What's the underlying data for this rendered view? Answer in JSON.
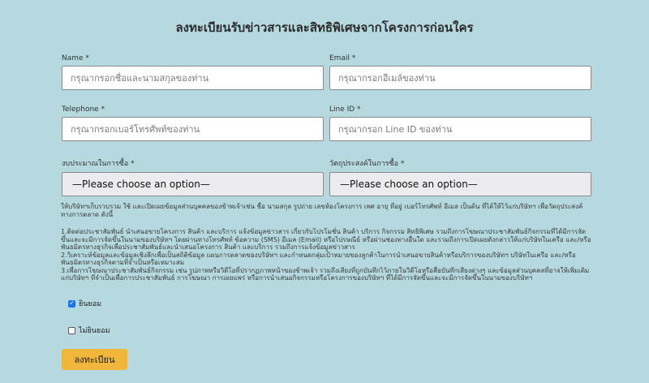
{
  "form": {
    "title": "ลงทะเบียนรับข่าวสารและสิทธิพิเศษจากโครงการก่อนใคร",
    "name": {
      "label": "Name *",
      "placeholder": "กรุณากรอกชื่อและนามสกุลของท่าน",
      "value": ""
    },
    "email": {
      "label": "Email *",
      "placeholder": "กรุณากรอกอีเมล์ของท่าน",
      "value": ""
    },
    "telephone": {
      "label": "Telephone *",
      "placeholder": "กรุณากรอกเบอร์โทรศัพท์ของท่าน",
      "value": ""
    },
    "line_id": {
      "label": "Line ID *",
      "placeholder": "กรุณากรอก Line ID ของท่าน",
      "value": ""
    },
    "budget": {
      "label": "งบประมาณในการซื้อ *",
      "selected": "—Please choose an option—"
    },
    "purpose": {
      "label": "วัตถุประสงค์ในการซื้อ *",
      "selected": "—Please choose an option—"
    },
    "consent_intro": "ให้บริษัทฯเก็บรวบรวม ใช้ และเปิดเผยข้อมูลส่วนบุคคลของข้าพเจ้าเช่น ชื่อ นามสกุล รูปถ่าย เลขห้องโครงการ เพศ อายุ ที่อยู่ เบอร์โทรศัพท์ อีเมล เป็นต้น ที่ได้ให้ไว้แก่บริษัทฯ เพื่อวัตถุประสงค์ทางการตลาด ดังนี้",
    "consent_items": [
      "1.ติดต่อประชาสัมพันธ์ นำเสนอขายโครงการ สินค้า และบริการ แจ้งข้อมูลข่าวสาร เกี่ยวกับโปรโมชั่น สินค้า บริการ กิจกรรม สิทธิพิเศษ รวมถึงการโฆษณาประชาสัมพันธ์กิจกรรมที่ได้มีการจัดขึ้นและจะมีการจัดขึ้นในนามของบริษัทฯ โดยผ่านทางโทรศัพท์ ข้อความ (SMS) อีเมล (Email) หรือไปรษณีย์ หรือผ่านช่องทางอื่นใด และรวมถึงการเปิดเผยดังกล่าวให้แก่บริษัทในเครือ และ/หรือพันธมิตรทางธุรกิจเพื่อประชาสัมพันธ์และนำเสนอโครงการ สินค้า และบริการ รวมถึงการแจ้งข้อมูลข่าวสาร",
      "2.วิเคราะห์ข้อมูลและข้อมูลเชิงลึกเพื่อเป็นสถิติข้อมูล แผนการตลาดของบริษัทฯ และกำหนดกลุ่มเป้าหมายของลูกค้าในการนำเสนอขายสินค้าหรือบริการของบริษัทฯ บริษัทในเครือ และ/หรือพันธมิตรทางธุรกิจตามที่จำเป็นหรือเหมาะสม",
      "3.เพื่อการโฆษณาประชาสัมพันธ์กิจกรรม เช่น รูปภาพหรือวิดีโอที่ปรากฏภาพหน้าของข้าพเจ้า รวมถึงเสียงที่ถูกบันทึกไว้ภายในวิดีโอหรือสื่อบันทึกเสียงต่างๆ และข้อมูลส่วนบุคคลที่อาจให้เพิ่มเติมแก่บริษัทฯ ที่จำเป็นเพื่อการประชาสัมพันธ์ การโฆษณา การเผยแพร่ หรือการนำเสนอกิจกรรมหรือโครงการของบริษัทฯ ที่ได้มีการจัดขึ้นและจะมีการจัดขึ้นในนามของบริษัทฯ"
    ],
    "consent_yes": {
      "label": "ยินยอม",
      "checked": true
    },
    "consent_no": {
      "label": "ไม่ยินยอม",
      "checked": false
    },
    "submit_label": "ลงทะเบียน"
  },
  "colors": {
    "background": "#b5d9df",
    "submit": "#f0b63a",
    "checkbox_checked": "#1a73e8"
  }
}
